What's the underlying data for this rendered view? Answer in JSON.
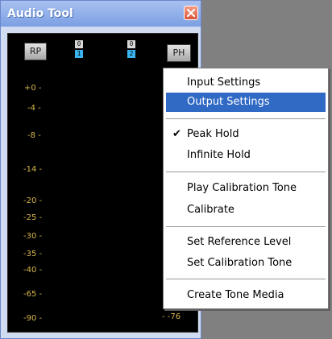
{
  "window": {
    "title": "Audio Tool"
  },
  "meter": {
    "rp_button": "RP",
    "ph_button": "PH",
    "channels": [
      {
        "peak": "0",
        "number": "1"
      },
      {
        "peak": "0",
        "number": "2"
      }
    ],
    "scale_labels": [
      "+0 -",
      "-4 -",
      "-8 -",
      "-14 -",
      "-20 -",
      "-25 -",
      "-30 -",
      "-35 -",
      "-40 -",
      "-65 -",
      "-90 -"
    ],
    "right_bottom_tick": "- -76",
    "colors": {
      "meter_background": "#000000",
      "scale_text": "#d7b54a",
      "channel_indicator": "#3ab4f0"
    }
  },
  "context_menu": {
    "items": [
      {
        "label": "Input Settings",
        "checked": false,
        "selected": false
      },
      {
        "label": "Output Settings",
        "checked": false,
        "selected": true
      },
      {
        "label": "Peak Hold",
        "checked": true,
        "selected": false
      },
      {
        "label": "Infinite Hold",
        "checked": false,
        "selected": false
      },
      {
        "label": "Play Calibration Tone",
        "checked": false,
        "selected": false
      },
      {
        "label": "Calibrate",
        "checked": false,
        "selected": false
      },
      {
        "label": "Set Reference Level",
        "checked": false,
        "selected": false
      },
      {
        "label": "Set Calibration Tone",
        "checked": false,
        "selected": false
      },
      {
        "label": "Create Tone Media",
        "checked": false,
        "selected": false
      }
    ],
    "check_glyph": "✔",
    "colors": {
      "highlight": "#316ac5"
    }
  }
}
